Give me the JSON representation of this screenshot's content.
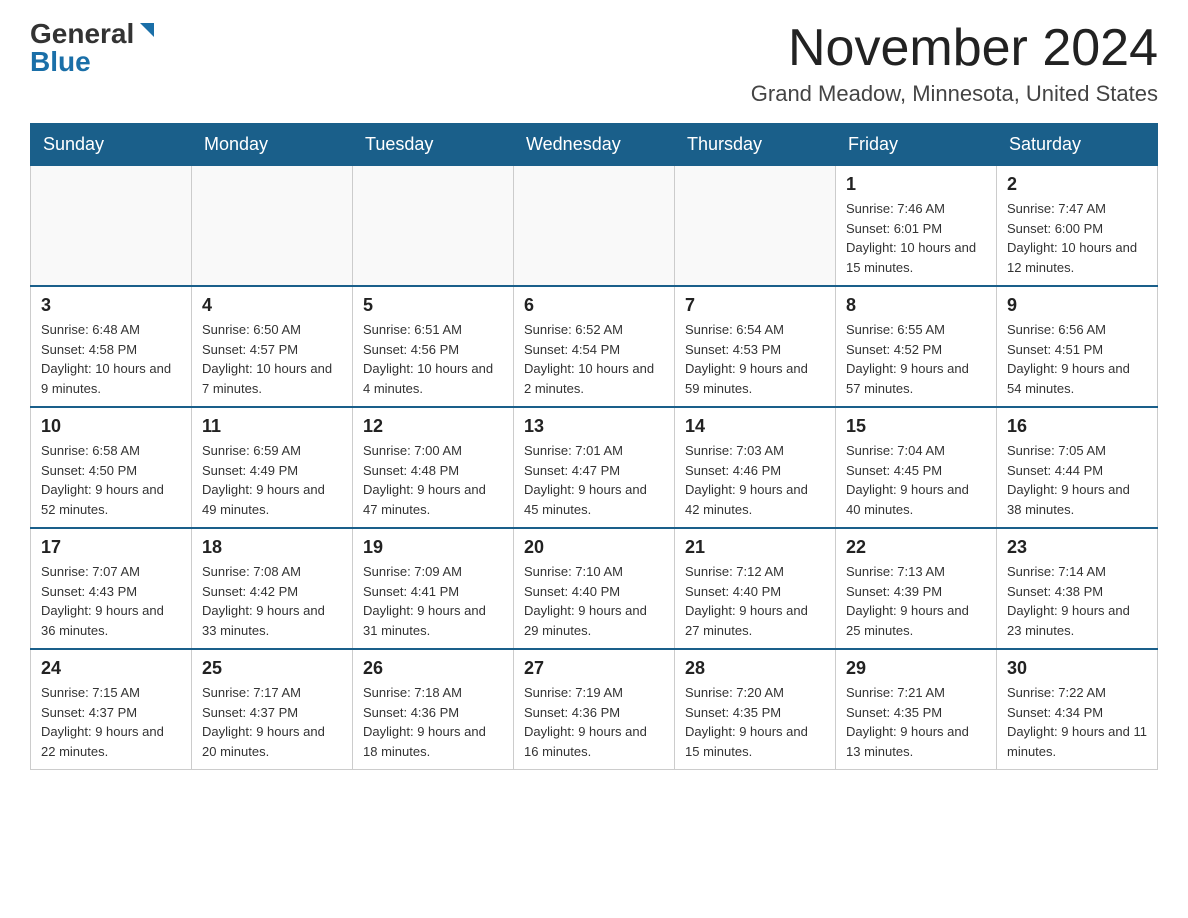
{
  "header": {
    "logo_general": "General",
    "logo_blue": "Blue",
    "month_title": "November 2024",
    "location": "Grand Meadow, Minnesota, United States"
  },
  "days_of_week": [
    "Sunday",
    "Monday",
    "Tuesday",
    "Wednesday",
    "Thursday",
    "Friday",
    "Saturday"
  ],
  "weeks": [
    [
      {
        "day": "",
        "sunrise": "",
        "sunset": "",
        "daylight": ""
      },
      {
        "day": "",
        "sunrise": "",
        "sunset": "",
        "daylight": ""
      },
      {
        "day": "",
        "sunrise": "",
        "sunset": "",
        "daylight": ""
      },
      {
        "day": "",
        "sunrise": "",
        "sunset": "",
        "daylight": ""
      },
      {
        "day": "",
        "sunrise": "",
        "sunset": "",
        "daylight": ""
      },
      {
        "day": "1",
        "sunrise": "Sunrise: 7:46 AM",
        "sunset": "Sunset: 6:01 PM",
        "daylight": "Daylight: 10 hours and 15 minutes."
      },
      {
        "day": "2",
        "sunrise": "Sunrise: 7:47 AM",
        "sunset": "Sunset: 6:00 PM",
        "daylight": "Daylight: 10 hours and 12 minutes."
      }
    ],
    [
      {
        "day": "3",
        "sunrise": "Sunrise: 6:48 AM",
        "sunset": "Sunset: 4:58 PM",
        "daylight": "Daylight: 10 hours and 9 minutes."
      },
      {
        "day": "4",
        "sunrise": "Sunrise: 6:50 AM",
        "sunset": "Sunset: 4:57 PM",
        "daylight": "Daylight: 10 hours and 7 minutes."
      },
      {
        "day": "5",
        "sunrise": "Sunrise: 6:51 AM",
        "sunset": "Sunset: 4:56 PM",
        "daylight": "Daylight: 10 hours and 4 minutes."
      },
      {
        "day": "6",
        "sunrise": "Sunrise: 6:52 AM",
        "sunset": "Sunset: 4:54 PM",
        "daylight": "Daylight: 10 hours and 2 minutes."
      },
      {
        "day": "7",
        "sunrise": "Sunrise: 6:54 AM",
        "sunset": "Sunset: 4:53 PM",
        "daylight": "Daylight: 9 hours and 59 minutes."
      },
      {
        "day": "8",
        "sunrise": "Sunrise: 6:55 AM",
        "sunset": "Sunset: 4:52 PM",
        "daylight": "Daylight: 9 hours and 57 minutes."
      },
      {
        "day": "9",
        "sunrise": "Sunrise: 6:56 AM",
        "sunset": "Sunset: 4:51 PM",
        "daylight": "Daylight: 9 hours and 54 minutes."
      }
    ],
    [
      {
        "day": "10",
        "sunrise": "Sunrise: 6:58 AM",
        "sunset": "Sunset: 4:50 PM",
        "daylight": "Daylight: 9 hours and 52 minutes."
      },
      {
        "day": "11",
        "sunrise": "Sunrise: 6:59 AM",
        "sunset": "Sunset: 4:49 PM",
        "daylight": "Daylight: 9 hours and 49 minutes."
      },
      {
        "day": "12",
        "sunrise": "Sunrise: 7:00 AM",
        "sunset": "Sunset: 4:48 PM",
        "daylight": "Daylight: 9 hours and 47 minutes."
      },
      {
        "day": "13",
        "sunrise": "Sunrise: 7:01 AM",
        "sunset": "Sunset: 4:47 PM",
        "daylight": "Daylight: 9 hours and 45 minutes."
      },
      {
        "day": "14",
        "sunrise": "Sunrise: 7:03 AM",
        "sunset": "Sunset: 4:46 PM",
        "daylight": "Daylight: 9 hours and 42 minutes."
      },
      {
        "day": "15",
        "sunrise": "Sunrise: 7:04 AM",
        "sunset": "Sunset: 4:45 PM",
        "daylight": "Daylight: 9 hours and 40 minutes."
      },
      {
        "day": "16",
        "sunrise": "Sunrise: 7:05 AM",
        "sunset": "Sunset: 4:44 PM",
        "daylight": "Daylight: 9 hours and 38 minutes."
      }
    ],
    [
      {
        "day": "17",
        "sunrise": "Sunrise: 7:07 AM",
        "sunset": "Sunset: 4:43 PM",
        "daylight": "Daylight: 9 hours and 36 minutes."
      },
      {
        "day": "18",
        "sunrise": "Sunrise: 7:08 AM",
        "sunset": "Sunset: 4:42 PM",
        "daylight": "Daylight: 9 hours and 33 minutes."
      },
      {
        "day": "19",
        "sunrise": "Sunrise: 7:09 AM",
        "sunset": "Sunset: 4:41 PM",
        "daylight": "Daylight: 9 hours and 31 minutes."
      },
      {
        "day": "20",
        "sunrise": "Sunrise: 7:10 AM",
        "sunset": "Sunset: 4:40 PM",
        "daylight": "Daylight: 9 hours and 29 minutes."
      },
      {
        "day": "21",
        "sunrise": "Sunrise: 7:12 AM",
        "sunset": "Sunset: 4:40 PM",
        "daylight": "Daylight: 9 hours and 27 minutes."
      },
      {
        "day": "22",
        "sunrise": "Sunrise: 7:13 AM",
        "sunset": "Sunset: 4:39 PM",
        "daylight": "Daylight: 9 hours and 25 minutes."
      },
      {
        "day": "23",
        "sunrise": "Sunrise: 7:14 AM",
        "sunset": "Sunset: 4:38 PM",
        "daylight": "Daylight: 9 hours and 23 minutes."
      }
    ],
    [
      {
        "day": "24",
        "sunrise": "Sunrise: 7:15 AM",
        "sunset": "Sunset: 4:37 PM",
        "daylight": "Daylight: 9 hours and 22 minutes."
      },
      {
        "day": "25",
        "sunrise": "Sunrise: 7:17 AM",
        "sunset": "Sunset: 4:37 PM",
        "daylight": "Daylight: 9 hours and 20 minutes."
      },
      {
        "day": "26",
        "sunrise": "Sunrise: 7:18 AM",
        "sunset": "Sunset: 4:36 PM",
        "daylight": "Daylight: 9 hours and 18 minutes."
      },
      {
        "day": "27",
        "sunrise": "Sunrise: 7:19 AM",
        "sunset": "Sunset: 4:36 PM",
        "daylight": "Daylight: 9 hours and 16 minutes."
      },
      {
        "day": "28",
        "sunrise": "Sunrise: 7:20 AM",
        "sunset": "Sunset: 4:35 PM",
        "daylight": "Daylight: 9 hours and 15 minutes."
      },
      {
        "day": "29",
        "sunrise": "Sunrise: 7:21 AM",
        "sunset": "Sunset: 4:35 PM",
        "daylight": "Daylight: 9 hours and 13 minutes."
      },
      {
        "day": "30",
        "sunrise": "Sunrise: 7:22 AM",
        "sunset": "Sunset: 4:34 PM",
        "daylight": "Daylight: 9 hours and 11 minutes."
      }
    ]
  ]
}
